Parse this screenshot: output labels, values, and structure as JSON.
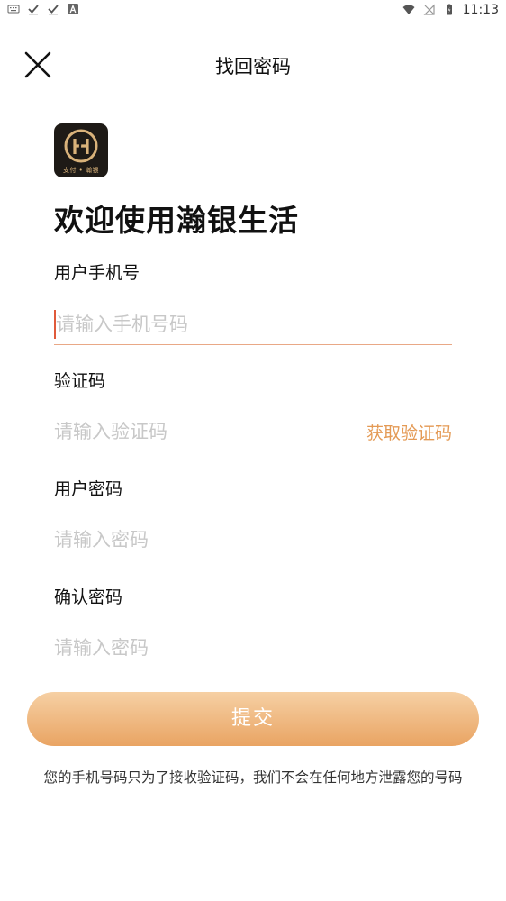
{
  "status_bar": {
    "time": "11:13",
    "left_icons": [
      "keyboard-icon",
      "check-icon",
      "check-icon",
      "a-icon"
    ],
    "right_icons": [
      "wifi-icon",
      "no-signal-icon",
      "battery-icon"
    ]
  },
  "header": {
    "title": "找回密码",
    "close_icon": "close-icon"
  },
  "logo": {
    "subtitle": "支付 • 瀚银"
  },
  "welcome": "欢迎使用瀚银生活",
  "form": {
    "phone": {
      "label": "用户手机号",
      "placeholder": "请输入手机号码",
      "value": ""
    },
    "code": {
      "label": "验证码",
      "placeholder": "请输入验证码",
      "value": "",
      "get_code_label": "获取验证码"
    },
    "password": {
      "label": "用户密码",
      "placeholder": "请输入密码",
      "value": ""
    },
    "confirm": {
      "label": "确认密码",
      "placeholder": "请输入密码",
      "value": ""
    }
  },
  "submit_label": "提交",
  "notice": "您的手机号码只为了接收验证码，我们不会在任何地方泄露您的号码",
  "colors": {
    "accent": "#e49a55",
    "button_top": "#f6d0a4",
    "button_bottom": "#e9a463",
    "cursor": "#e05a3b",
    "logo_bg": "#1e1a16",
    "logo_gold": "#d9b27a"
  }
}
